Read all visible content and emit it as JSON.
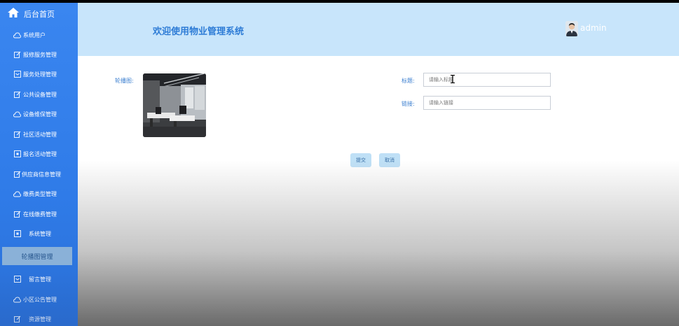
{
  "sidebar": {
    "home_label": "后台首页",
    "items": [
      {
        "label": "系统用户",
        "icon": "cloud-icon"
      },
      {
        "label": "报修服务管理",
        "icon": "edit-icon"
      },
      {
        "label": "服务处理管理",
        "icon": "message-icon"
      },
      {
        "label": "公共设备管理",
        "icon": "edit-icon"
      },
      {
        "label": "设备维保管理",
        "icon": "cloud-icon"
      },
      {
        "label": "社区活动管理",
        "icon": "edit-icon"
      },
      {
        "label": "报名活动管理",
        "icon": "box-icon"
      },
      {
        "label": "供应商信息管理",
        "icon": "edit-icon"
      },
      {
        "label": "缴费类型管理",
        "icon": "cloud-icon"
      },
      {
        "label": "在线缴费管理",
        "icon": "edit-icon"
      },
      {
        "label": "系统管理",
        "icon": "box-icon"
      },
      {
        "label": "留言管理",
        "icon": "message-icon"
      },
      {
        "label": "小区公告管理",
        "icon": "cloud-icon"
      },
      {
        "label": "资源管理",
        "icon": "edit-icon"
      }
    ],
    "active_label": "轮播图管理"
  },
  "header": {
    "title": "欢迎使用物业管理系统",
    "user": "admin"
  },
  "form": {
    "carousel_label": "轮播图:",
    "title_label": "标题:",
    "title_placeholder": "请输入标题",
    "link_label": "链接:",
    "link_placeholder": "请输入链接",
    "submit": "提交",
    "cancel": "取消"
  }
}
